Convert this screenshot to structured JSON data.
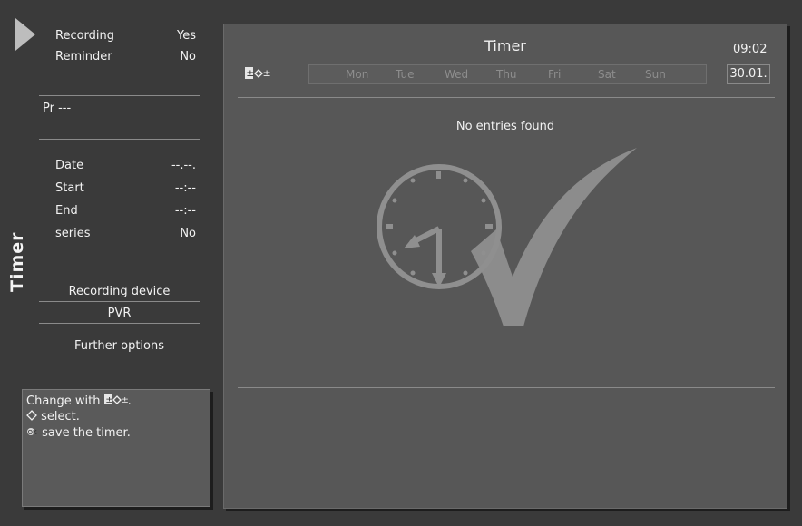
{
  "left": {
    "vertical_title": "Timer",
    "recording_label": "Recording",
    "recording_value": "Yes",
    "reminder_label": "Reminder",
    "reminder_value": "No",
    "programme": "Pr ---",
    "date_label": "Date",
    "date_value": "--.--.",
    "start_label": "Start",
    "start_value": "--:--",
    "end_label": "End",
    "end_value": "--:--",
    "series_label": "series",
    "series_value": "No",
    "recording_device_label": "Recording device",
    "recording_device_value": "PVR",
    "further_options": "Further options"
  },
  "help": {
    "line1": "Change with",
    "line1_suffix": ".",
    "line2": "select.",
    "line3": "save the timer.",
    "ok_icon_text": "OK"
  },
  "main": {
    "title": "Timer",
    "time": "09:02",
    "date": "30.01.",
    "days": [
      "Mon",
      "Tue",
      "Wed",
      "Thu",
      "Fri",
      "Sat",
      "Sun"
    ],
    "empty_message": "No entries found"
  },
  "colors": {
    "background": "#3a3a3a",
    "panel": "#575757",
    "text": "#f2f2f2",
    "inactive_day": "#8d8d8d",
    "graphic": "#8f8f8f"
  },
  "icons": [
    "play-icon",
    "change-icon",
    "navigate-icon",
    "ok-icon",
    "clock-icon",
    "checkmark-icon"
  ]
}
